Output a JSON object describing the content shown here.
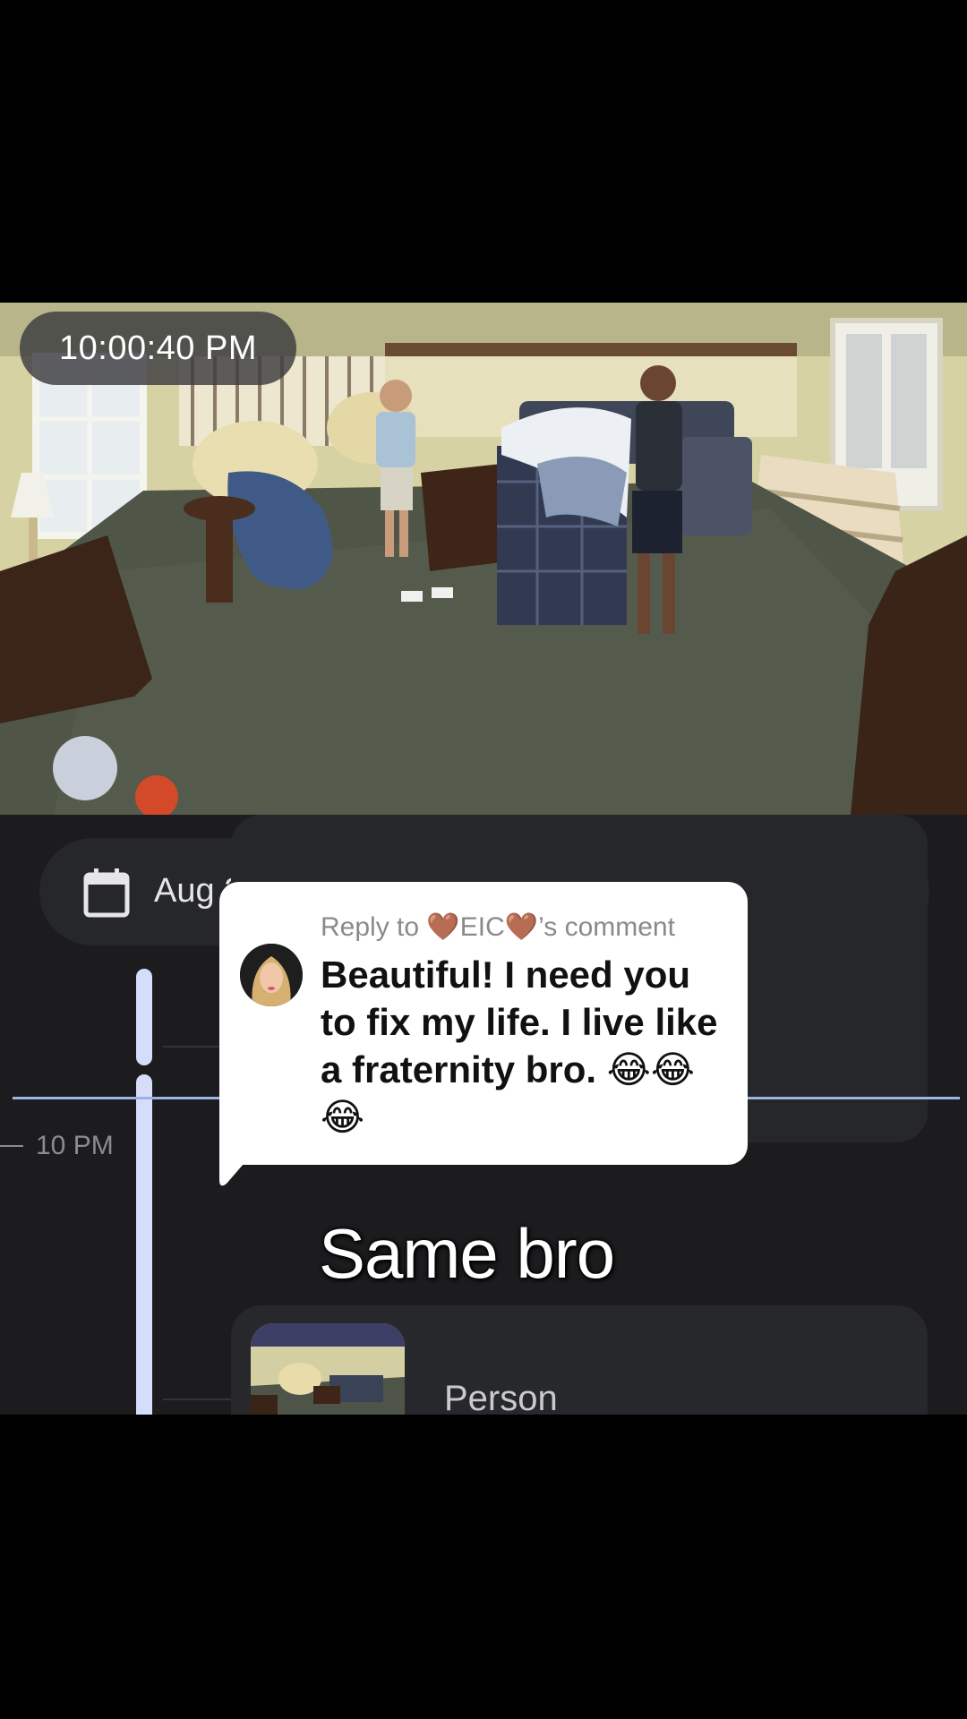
{
  "feed": {
    "timestamp": "10:00:40 PM"
  },
  "toolbar": {
    "date_label": "Aug 21",
    "calendar_icon": "calendar-icon",
    "search_icon": "smart-search-icon",
    "view_icon": "layout-toggle-icon"
  },
  "timeline": {
    "hour_label": "10 PM",
    "event_label": "Person"
  },
  "comment": {
    "reply_prefix": "Reply to ",
    "heart_1": "🤎",
    "username": "EIC",
    "heart_2": "🤎",
    "reply_suffix": "’s comment",
    "text": "Beautiful! I need you to fix my life. I live like a fraternity bro. 😂😂😂"
  },
  "caption": "Same bro",
  "colors": {
    "panel_bg": "#1c1c1f",
    "button_bg": "#26272b",
    "timeline_accent": "#d6ddfb",
    "now_line": "#9fb2e4"
  }
}
